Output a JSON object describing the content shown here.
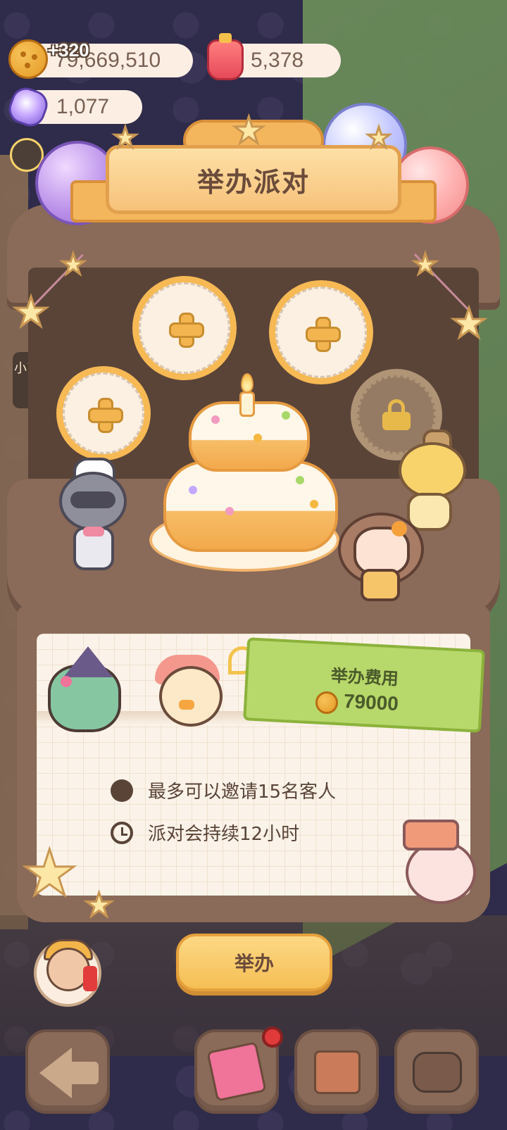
{
  "currency": {
    "coins": "79,669,510",
    "coin_gain": "+320",
    "jam": "5,378",
    "crystals": "1,077"
  },
  "side": {
    "chip_text": "小了"
  },
  "party": {
    "title": "举办派对",
    "slots": [
      {
        "state": "empty",
        "icon": "plus-icon"
      },
      {
        "state": "empty",
        "icon": "plus-icon"
      },
      {
        "state": "empty",
        "icon": "plus-icon"
      },
      {
        "state": "locked",
        "icon": "lock-icon"
      }
    ],
    "cost_label": "举办费用",
    "cost_value": "79000",
    "info": {
      "guests": "最多可以邀请15名客人",
      "duration": "派对会持续12小时"
    },
    "host_button": "举办"
  },
  "toolbar": {
    "items": [
      "back-arrow-icon",
      "decorate-icon",
      "build-icon",
      "furniture-icon"
    ],
    "notification": true
  },
  "colors": {
    "accent": "#f5bf55",
    "cost_tag": "#b7d86a",
    "notification": "#e03a3a"
  }
}
